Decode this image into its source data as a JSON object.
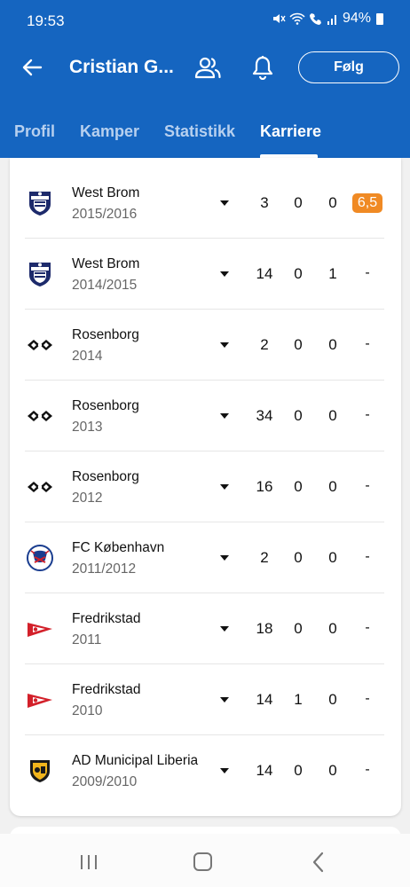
{
  "status_bar": {
    "time": "19:53",
    "battery": "94%"
  },
  "toolbar": {
    "title": "Cristian G...",
    "follow_label": "Følg"
  },
  "tabs": [
    {
      "label": "Profil"
    },
    {
      "label": "Kamper"
    },
    {
      "label": "Statistikk"
    },
    {
      "label": "Karriere"
    }
  ],
  "active_tab": "Karriere",
  "career": [
    {
      "club": "West Brom",
      "season": "2015/2016",
      "apps": "3",
      "goals": "0",
      "assists": "0",
      "rating": "6,5",
      "logo": "west-brom-logo"
    },
    {
      "club": "West Brom",
      "season": "2014/2015",
      "apps": "14",
      "goals": "0",
      "assists": "1",
      "rating": "-",
      "logo": "west-brom-logo"
    },
    {
      "club": "Rosenborg",
      "season": "2014",
      "apps": "2",
      "goals": "0",
      "assists": "0",
      "rating": "-",
      "logo": "rosenborg-logo"
    },
    {
      "club": "Rosenborg",
      "season": "2013",
      "apps": "34",
      "goals": "0",
      "assists": "0",
      "rating": "-",
      "logo": "rosenborg-logo"
    },
    {
      "club": "Rosenborg",
      "season": "2012",
      "apps": "16",
      "goals": "0",
      "assists": "0",
      "rating": "-",
      "logo": "rosenborg-logo"
    },
    {
      "club": "FC København",
      "season": "2011/2012",
      "apps": "2",
      "goals": "0",
      "assists": "0",
      "rating": "-",
      "logo": "fc-kobenhavn-logo"
    },
    {
      "club": "Fredrikstad",
      "season": "2011",
      "apps": "18",
      "goals": "0",
      "assists": "0",
      "rating": "-",
      "logo": "fredrikstad-logo"
    },
    {
      "club": "Fredrikstad",
      "season": "2010",
      "apps": "14",
      "goals": "1",
      "assists": "0",
      "rating": "-",
      "logo": "fredrikstad-logo"
    },
    {
      "club": "AD Municipal Liberia",
      "season": "2009/2010",
      "apps": "14",
      "goals": "0",
      "assists": "0",
      "rating": "-",
      "logo": "municipal-liberia-logo"
    }
  ],
  "colors": {
    "primary": "#1565c0",
    "rating_badge": "#f08a24"
  }
}
